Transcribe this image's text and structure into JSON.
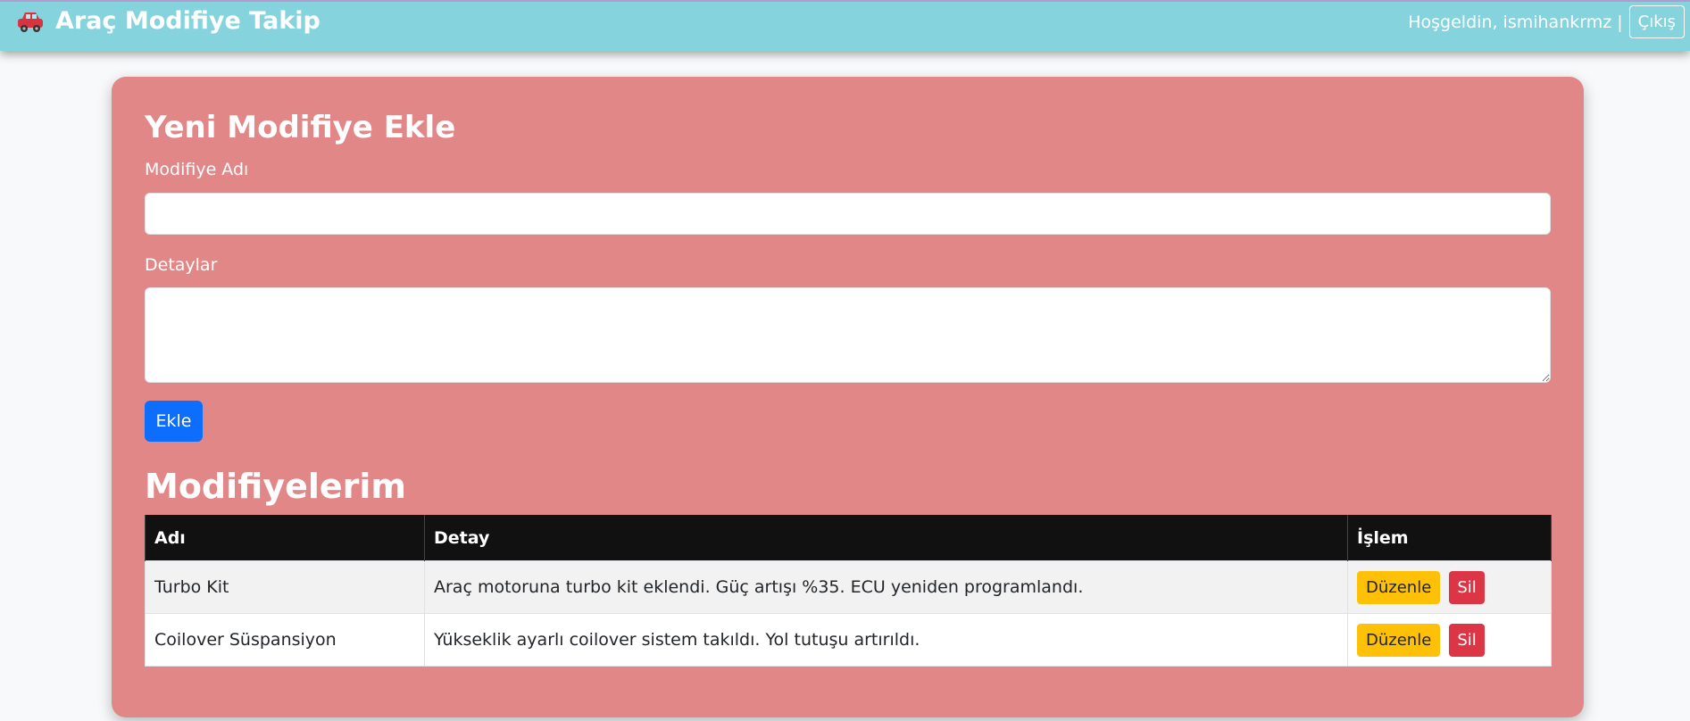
{
  "navbar": {
    "brand_icon": "car-icon",
    "brand_title": "Araç Modifiye Takip",
    "welcome_text": "Hoşgeldin, ismihankrmz",
    "separator": "|",
    "logout_label": "Çıkış"
  },
  "form": {
    "title": "Yeni Modifiye Ekle",
    "name_label": "Modifiye Adı",
    "name_value": "",
    "details_label": "Detaylar",
    "details_value": "",
    "submit_label": "Ekle"
  },
  "list": {
    "title": "Modifiyelerim",
    "columns": [
      "Adı",
      "Detay",
      "İşlem"
    ],
    "rows": [
      {
        "name": "Turbo Kit",
        "detail": "Araç motoruna turbo kit eklendi. Güç artışı %35. ECU yeniden programlandı.",
        "edit_label": "Düzenle",
        "delete_label": "Sil"
      },
      {
        "name": "Coilover Süspansiyon",
        "detail": "Yükseklik ayarlı coilover sistem takıldı. Yol tutuşu artırıldı.",
        "edit_label": "Düzenle",
        "delete_label": "Sil"
      }
    ]
  },
  "colors": {
    "navbar": "#85d4dd",
    "card": "#e28787",
    "primary": "#0d6efd",
    "warning": "#ffc107",
    "danger": "#dc3545",
    "table_header": "#111111"
  }
}
